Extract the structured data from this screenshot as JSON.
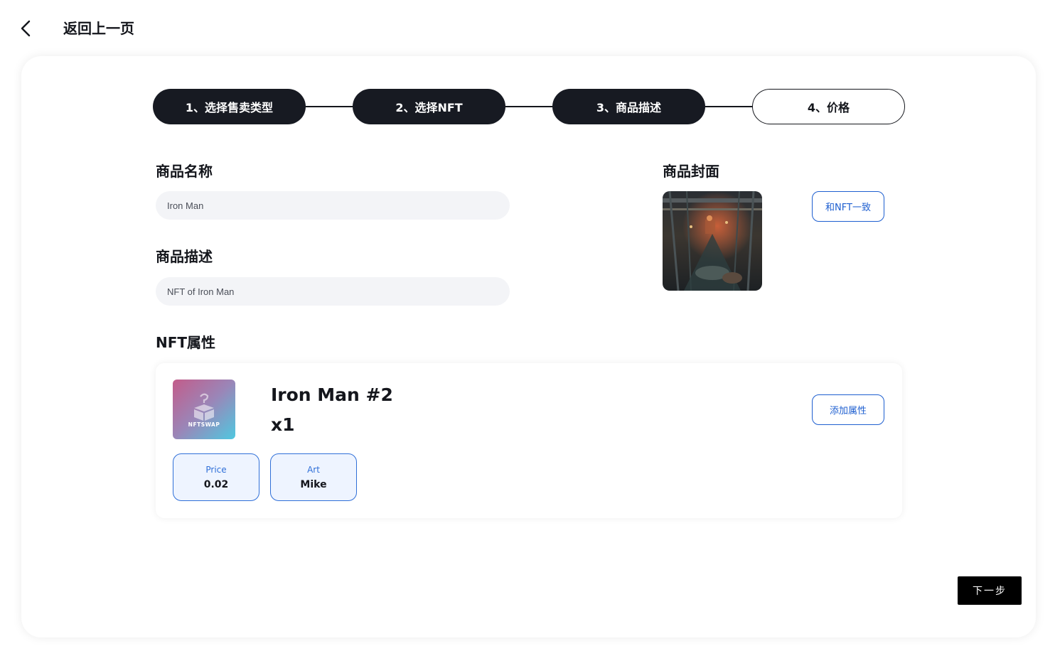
{
  "header": {
    "back_label": "返回上一页"
  },
  "steps": [
    {
      "label": "1、选择售卖类型",
      "state": "done"
    },
    {
      "label": "2、选择NFT",
      "state": "done"
    },
    {
      "label": "3、商品描述",
      "state": "done"
    },
    {
      "label": "4、价格",
      "state": "todo"
    }
  ],
  "form": {
    "name_title": "商品名称",
    "name_value": "Iron Man",
    "desc_title": "商品描述",
    "desc_value": "NFT of Iron Man",
    "cover_title": "商品封面",
    "same_as_nft_label": "和NFT一致",
    "attr_title": "NFT属性"
  },
  "nft": {
    "thumb_brand": "NFTSWAP",
    "name": "Iron Man #2",
    "quantity": "x1",
    "add_attr_label": "添加属性",
    "attributes": [
      {
        "key": "Price",
        "value": "0.02"
      },
      {
        "key": "Art",
        "value": "Mike"
      }
    ]
  },
  "footer": {
    "next_label": "下一步"
  },
  "colors": {
    "accent": "#1e5fd0",
    "dark": "#171a22",
    "field_bg": "#f3f4f7"
  },
  "icons": {
    "back": "chevron-left-icon",
    "thumb": "gift-box-icon"
  }
}
